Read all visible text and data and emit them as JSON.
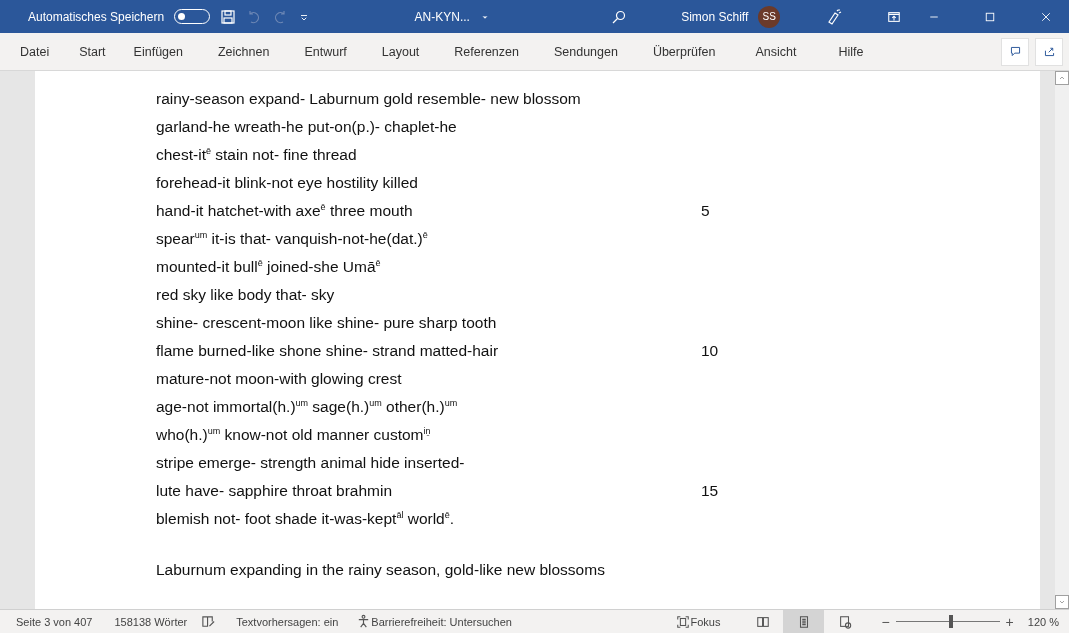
{
  "title_bar": {
    "autosave_label": "Automatisches Speichern",
    "autosave_on": false,
    "document": "AN-KYN...",
    "user": "Simon Schiff",
    "avatar": "SS"
  },
  "menu": [
    {
      "label": "Datei",
      "selected": false
    },
    {
      "label": "Start",
      "selected": false
    },
    {
      "label": "Einfügen",
      "selected": false
    },
    {
      "label": "Zeichnen",
      "selected": false
    },
    {
      "label": "Entwurf",
      "selected": false
    },
    {
      "label": "Layout",
      "selected": false
    },
    {
      "label": "Referenzen",
      "selected": false
    },
    {
      "label": "Sendungen",
      "selected": false
    },
    {
      "label": "Überprüfen",
      "selected": false
    },
    {
      "label": "Ansicht",
      "selected": false
    },
    {
      "label": "Hilfe",
      "selected": false
    }
  ],
  "document": {
    "verse_lines": [
      {
        "text": "rainy-season expand- Laburnum gold resemble- new blossom"
      },
      {
        "text": "garland-he wreath-he put-on(p.)- chaplet-he"
      },
      {
        "text": "chest-it$^{ē}$ stain not- fine thread"
      },
      {
        "text": "forehead-it blink-not eye hostility killed"
      },
      {
        "text": "hand-it hatchet-with axe$^{ē}$ three mouth",
        "number": "5"
      },
      {
        "text": "spear$^{um}$ it-is that- vanquish-not-he(dat.)$^{ē}$"
      },
      {
        "text": "mounted-it bull$^{ē}$ joined-she Umā$^{ē}$"
      },
      {
        "text": "red sky like body that- sky"
      },
      {
        "text": "shine- crescent-moon like shine- pure sharp tooth"
      },
      {
        "text": "flame burned-like shone shine- strand matted-hair",
        "number": "10"
      },
      {
        "text": "mature-not moon-with glowing crest"
      },
      {
        "text": "age-not immortal(h.)$^{um}$ sage(h.)$^{um}$ other(h.)$^{um}$"
      },
      {
        "text": "who(h.)$^{um}$ know-not old manner custom$^{iṉ}$"
      },
      {
        "text": "stripe emerge- strength animal hide inserted-"
      },
      {
        "text": "lute have- sapphire throat brahmin",
        "number": "15"
      },
      {
        "text": "blemish not- foot shade it-was-kept$^{āl}$ world$^{ē}$."
      }
    ],
    "paragraph": "Laburnum expanding in the rainy season, gold-like new blossoms"
  },
  "status_bar": {
    "page": "Seite 3 von 407",
    "words": "158138 Wörter",
    "prediction": "Textvorhersagen: ein",
    "accessibility": "Barrierefreiheit: Untersuchen",
    "focus": "Fokus",
    "views": [
      {
        "kind": "read",
        "selected": false
      },
      {
        "kind": "print",
        "selected": true
      },
      {
        "kind": "web",
        "selected": false
      }
    ],
    "zoom": {
      "minus": "−",
      "plus": "+",
      "level": 0.53,
      "reading": "120 %"
    }
  }
}
